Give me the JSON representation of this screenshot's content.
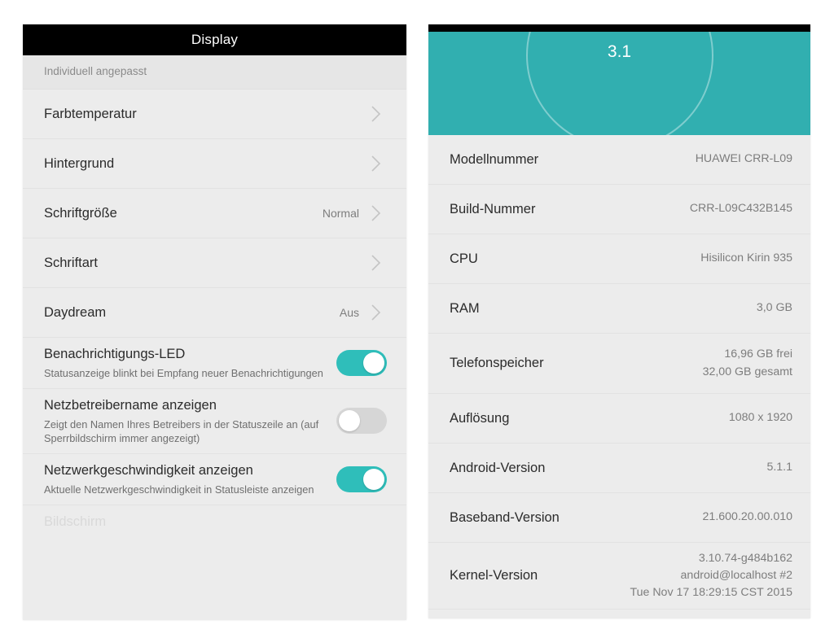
{
  "left_panel": {
    "titlebar": {
      "title": "Display"
    },
    "section_header": {
      "label": "Individuell angepasst"
    },
    "rows": [
      {
        "title": "Farbtemperatur",
        "value": "",
        "sub": "",
        "control": "chevron"
      },
      {
        "title": "Hintergrund",
        "value": "",
        "sub": "",
        "control": "chevron"
      },
      {
        "title": "Schriftgröße",
        "value": "Normal",
        "sub": "",
        "control": "chevron"
      },
      {
        "title": "Schriftart",
        "value": "",
        "sub": "",
        "control": "chevron"
      },
      {
        "title": "Daydream",
        "value": "Aus",
        "sub": "",
        "control": "chevron"
      },
      {
        "title": "Benachrichtigungs-LED",
        "value": "",
        "sub": "Statusanzeige blinkt bei Empfang neuer Benachrichtigungen",
        "control": "toggle",
        "toggle_state": "on"
      },
      {
        "title": "Netzbetreibername anzeigen",
        "value": "",
        "sub": "Zeigt den Namen Ihres Betreibers in der Statuszeile an (auf Sperrbildschirm immer angezeigt)",
        "control": "toggle",
        "toggle_state": "off"
      },
      {
        "title": "Netzwerkgeschwindigkeit anzeigen",
        "value": "",
        "sub": "Aktuelle Netzwerkgeschwindigkeit in Statusleiste anzeigen",
        "control": "toggle",
        "toggle_state": "on"
      }
    ],
    "clipped_row": {
      "title": "Bildschirm"
    }
  },
  "right_panel": {
    "hero": {
      "version": "3.1"
    },
    "rows": [
      {
        "label": "Modellnummer",
        "value": "HUAWEI CRR-L09"
      },
      {
        "label": "Build-Nummer",
        "value": "CRR-L09C432B145"
      },
      {
        "label": "CPU",
        "value": "Hisilicon Kirin 935"
      },
      {
        "label": "RAM",
        "value": "3,0 GB"
      },
      {
        "label": "Telefonspeicher",
        "value": "16,96  GB frei\n32,00  GB gesamt"
      },
      {
        "label": "Auflösung",
        "value": "1080 x 1920"
      },
      {
        "label": "Android-Version",
        "value": "5.1.1"
      },
      {
        "label": "Baseband-Version",
        "value": "21.600.20.00.010"
      },
      {
        "label": "Kernel-Version",
        "value": "3.10.74-g484b162\nandroid@localhost #2\nTue Nov 17 18:29:15 CST 2015"
      }
    ]
  },
  "colors": {
    "teal_hero": "#31afb0",
    "teal_toggle": "#2fbeba",
    "row_background": "#ececec",
    "titlebar": "#000000",
    "divider": "#e2e2e2"
  }
}
